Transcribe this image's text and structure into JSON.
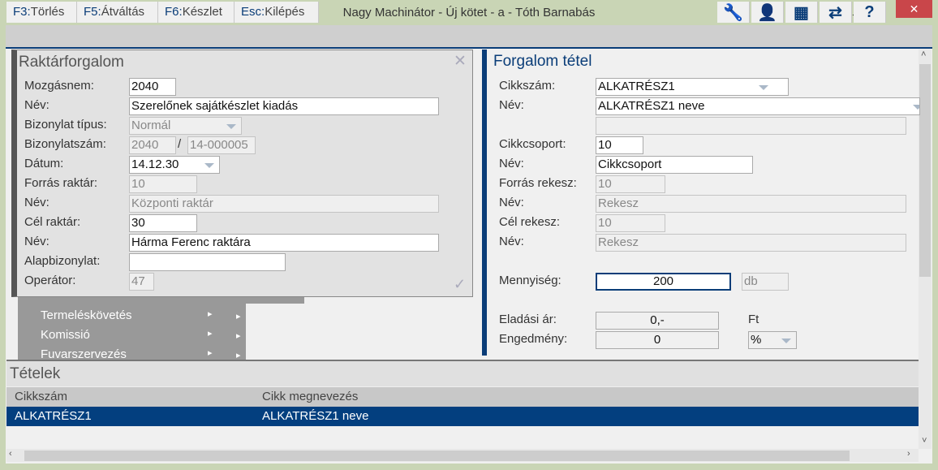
{
  "window": {
    "title": "Nagy Machinátor - Új kötet - a - Tóth Barnabás",
    "logo": "ꟺ",
    "minimize": "_",
    "maximize": "☐",
    "close": "✕"
  },
  "toolbar": {
    "tabs": [
      {
        "key": "F3:",
        "label": "Törlés"
      },
      {
        "key": "F5:",
        "label": "Átváltás"
      },
      {
        "key": "F6:",
        "label": "Készlet"
      },
      {
        "key": "Esc:",
        "label": "Kilépés"
      }
    ],
    "icons": [
      "wrench-icon",
      "user-icon",
      "grid-icon",
      "swap-icon",
      "help-icon"
    ]
  },
  "left_panel": {
    "title": "Raktárforgalom",
    "close": "✕",
    "check": "✓",
    "fields": [
      {
        "label": "Mozgásnem:",
        "value": "2040"
      },
      {
        "label": "Név:",
        "value": "Szerelőnek sajátkészlet kiadás"
      },
      {
        "label": "Bizonylat típus:",
        "value": "Normál"
      },
      {
        "label": "Bizonylatszám:",
        "value": "2040",
        "separator": "/",
        "value2": "14-000005"
      },
      {
        "label": "Dátum:",
        "value": "14.12.30"
      },
      {
        "label": "Forrás raktár:",
        "value": "10"
      },
      {
        "label": "Név:",
        "value": "Központi raktár"
      },
      {
        "label": "Cél raktár:",
        "value": "30"
      },
      {
        "label": "Név:",
        "value": "Hárma Ferenc raktára"
      },
      {
        "label": "Alapbizonylat:",
        "value": ""
      },
      {
        "label": "Operátor:",
        "value": "47"
      }
    ]
  },
  "menu": {
    "items": [
      "Termeléskövetés",
      "Komissió",
      "Fuvarszervezés"
    ],
    "arrow": "▸"
  },
  "right_panel": {
    "title": "Forgalom tétel",
    "fields": [
      {
        "label": "Cikkszám:",
        "value": "ALKATRÉSZ1"
      },
      {
        "label": "Név:",
        "value": "ALKATRÉSZ1 neve"
      },
      {
        "label": "",
        "value": ""
      },
      {
        "label": "Cikkcsoport:",
        "value": "10"
      },
      {
        "label": "Név:",
        "value": "Cikkcsoport"
      },
      {
        "label": "Forrás rekesz:",
        "value": "10"
      },
      {
        "label": "Név:",
        "value": "Rekesz"
      },
      {
        "label": "Cél rekesz:",
        "value": "10"
      },
      {
        "label": "Név:",
        "value": "Rekesz"
      },
      {
        "label": "Mennyiség:",
        "value": "200",
        "unit": "db"
      },
      {
        "label": "Eladási ár:",
        "value": "0,-",
        "unit": "Ft"
      },
      {
        "label": "Engedmény:",
        "value": "0",
        "unit": "%"
      }
    ]
  },
  "items": {
    "title": "Tételek",
    "columns": [
      "Cikkszám",
      "Cikk megnevezés"
    ],
    "rows": [
      [
        "ALKATRÉSZ1",
        "ALKATRÉSZ1 neve"
      ]
    ]
  },
  "colors": {
    "accent": "#0a3d78",
    "selected_row": "#033f7f",
    "close": "#c9464a",
    "frame": "#c9d5b5"
  }
}
